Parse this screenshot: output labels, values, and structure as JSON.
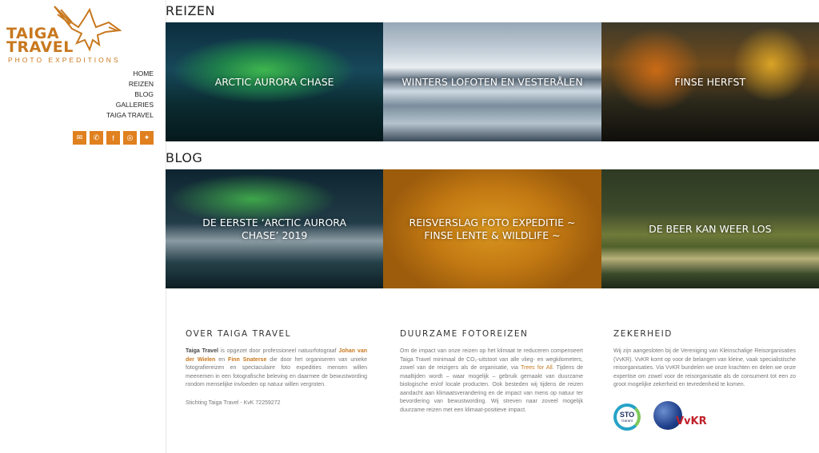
{
  "brand": {
    "line1": "TAIGA",
    "line2": "TRAVEL",
    "tagline": "PHOTO EXPEDITIONS",
    "color": "#c8781e"
  },
  "nav": [
    "HOME",
    "REIZEN",
    "BLOG",
    "GALLERIES",
    "TAIGA TRAVEL"
  ],
  "social": [
    {
      "icon": "envelope-icon",
      "glyph": "✉"
    },
    {
      "icon": "phone-icon",
      "glyph": "✆"
    },
    {
      "icon": "facebook-icon",
      "glyph": "f"
    },
    {
      "icon": "instagram-icon",
      "glyph": "◎"
    },
    {
      "icon": "twitter-icon",
      "glyph": "✦"
    }
  ],
  "reizen": {
    "title": "REIZEN",
    "tiles": [
      "ARCTIC AURORA CHASE",
      "WINTERS LOFOTEN EN VESTERÅLEN",
      "FINSE HERFST"
    ]
  },
  "blog": {
    "title": "BLOG",
    "tiles": [
      "DE EERSTE ‘ARCTIC AURORA CHASE’ 2019",
      "REISVERSLAG FOTO EXPEDITIE ~ FINSE LENTE & WILDLIFE ~",
      "DE BEER KAN WEER LOS"
    ]
  },
  "footer": {
    "about": {
      "title": "OVER TAIGA TRAVEL",
      "brand": "Taiga Travel",
      "t1": "is opgezet door professioneel natuurfotograaf",
      "link1": "Johan van der Wielen",
      "t2": "en",
      "link2": "Finn Snaterse",
      "t3": "die door het organiseren van unieke fotografiereizen en spectaculaire foto expedities mensen willen meenemen in een fotografische beleving en daarmee de bewustwording rondom menselijke invloeden op natuur willen vergroten.",
      "kvk": "Stichting Taiga Travel - KvK 72259272"
    },
    "sustainable": {
      "title": "DUURZAME FOTOREIZEN",
      "t1": "Om de impact van onze reizen op het klimaat te reduceren compenseert Taiga Travel minimaal de CO₂-uitstoot van alle vlieg- en wegkilometers, zowel van de reizigers als de organisatie, via",
      "link": "Trees for All",
      "t2": ". Tijdens de maaltijden wordt – waar mogelijk – gebruik gemaakt van duurzame biologische en/of locale producten. Ook besteden wij tijdens de reizen aandacht aan klimaatsverandering en de impact van mens op natuur ter bevordering van bewustwording. Wij streven naar zoveel mogelijk duurzame reizen met een klimaat-positieve impact."
    },
    "security": {
      "title": "ZEKERHEID",
      "text": "Wij zijn aangesloten bij de Vereniging van Kleinschalige Reisorganisaties (VvKR). VvKR komt op voor de belangen van kleine, vaak specialistische reisorganisaties. Via VvKR bundelen we onze krachten en delen we onze expertise om zowel voor de reisorganisatie als de consument tot een zo groot mogelijke zekerheid en tevredenheid te komen.",
      "sto_a": "STO",
      "sto_b": "Garant",
      "vvkr": "VvKR"
    }
  }
}
